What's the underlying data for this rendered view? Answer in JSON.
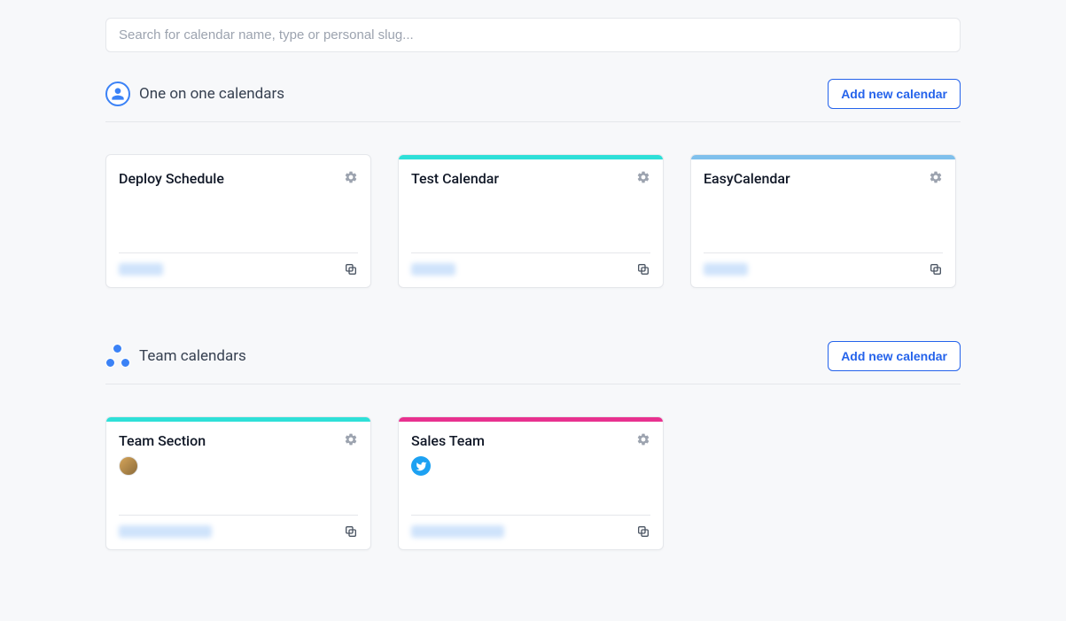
{
  "search": {
    "placeholder": "Search for calendar name, type or personal slug..."
  },
  "sections": {
    "one_on_one": {
      "title": "One on one calendars",
      "add_label": "Add new calendar"
    },
    "team": {
      "title": "Team calendars",
      "add_label": "Add new calendar"
    }
  },
  "cards": {
    "deploy": {
      "title": "Deploy Schedule",
      "stripe": "#ef5a7a"
    },
    "test": {
      "title": "Test Calendar",
      "stripe": "#2ee0d8"
    },
    "easy": {
      "title": "EasyCalendar",
      "stripe": "#7fc0ec"
    },
    "team_section": {
      "title": "Team Section",
      "stripe": "#2ee0d8"
    },
    "sales": {
      "title": "Sales Team",
      "stripe": "#e8318f"
    }
  },
  "icons": {
    "gear": "gear-icon",
    "copy": "copy-icon",
    "person": "person-icon",
    "team": "team-icon",
    "twitter": "twitter-icon"
  }
}
